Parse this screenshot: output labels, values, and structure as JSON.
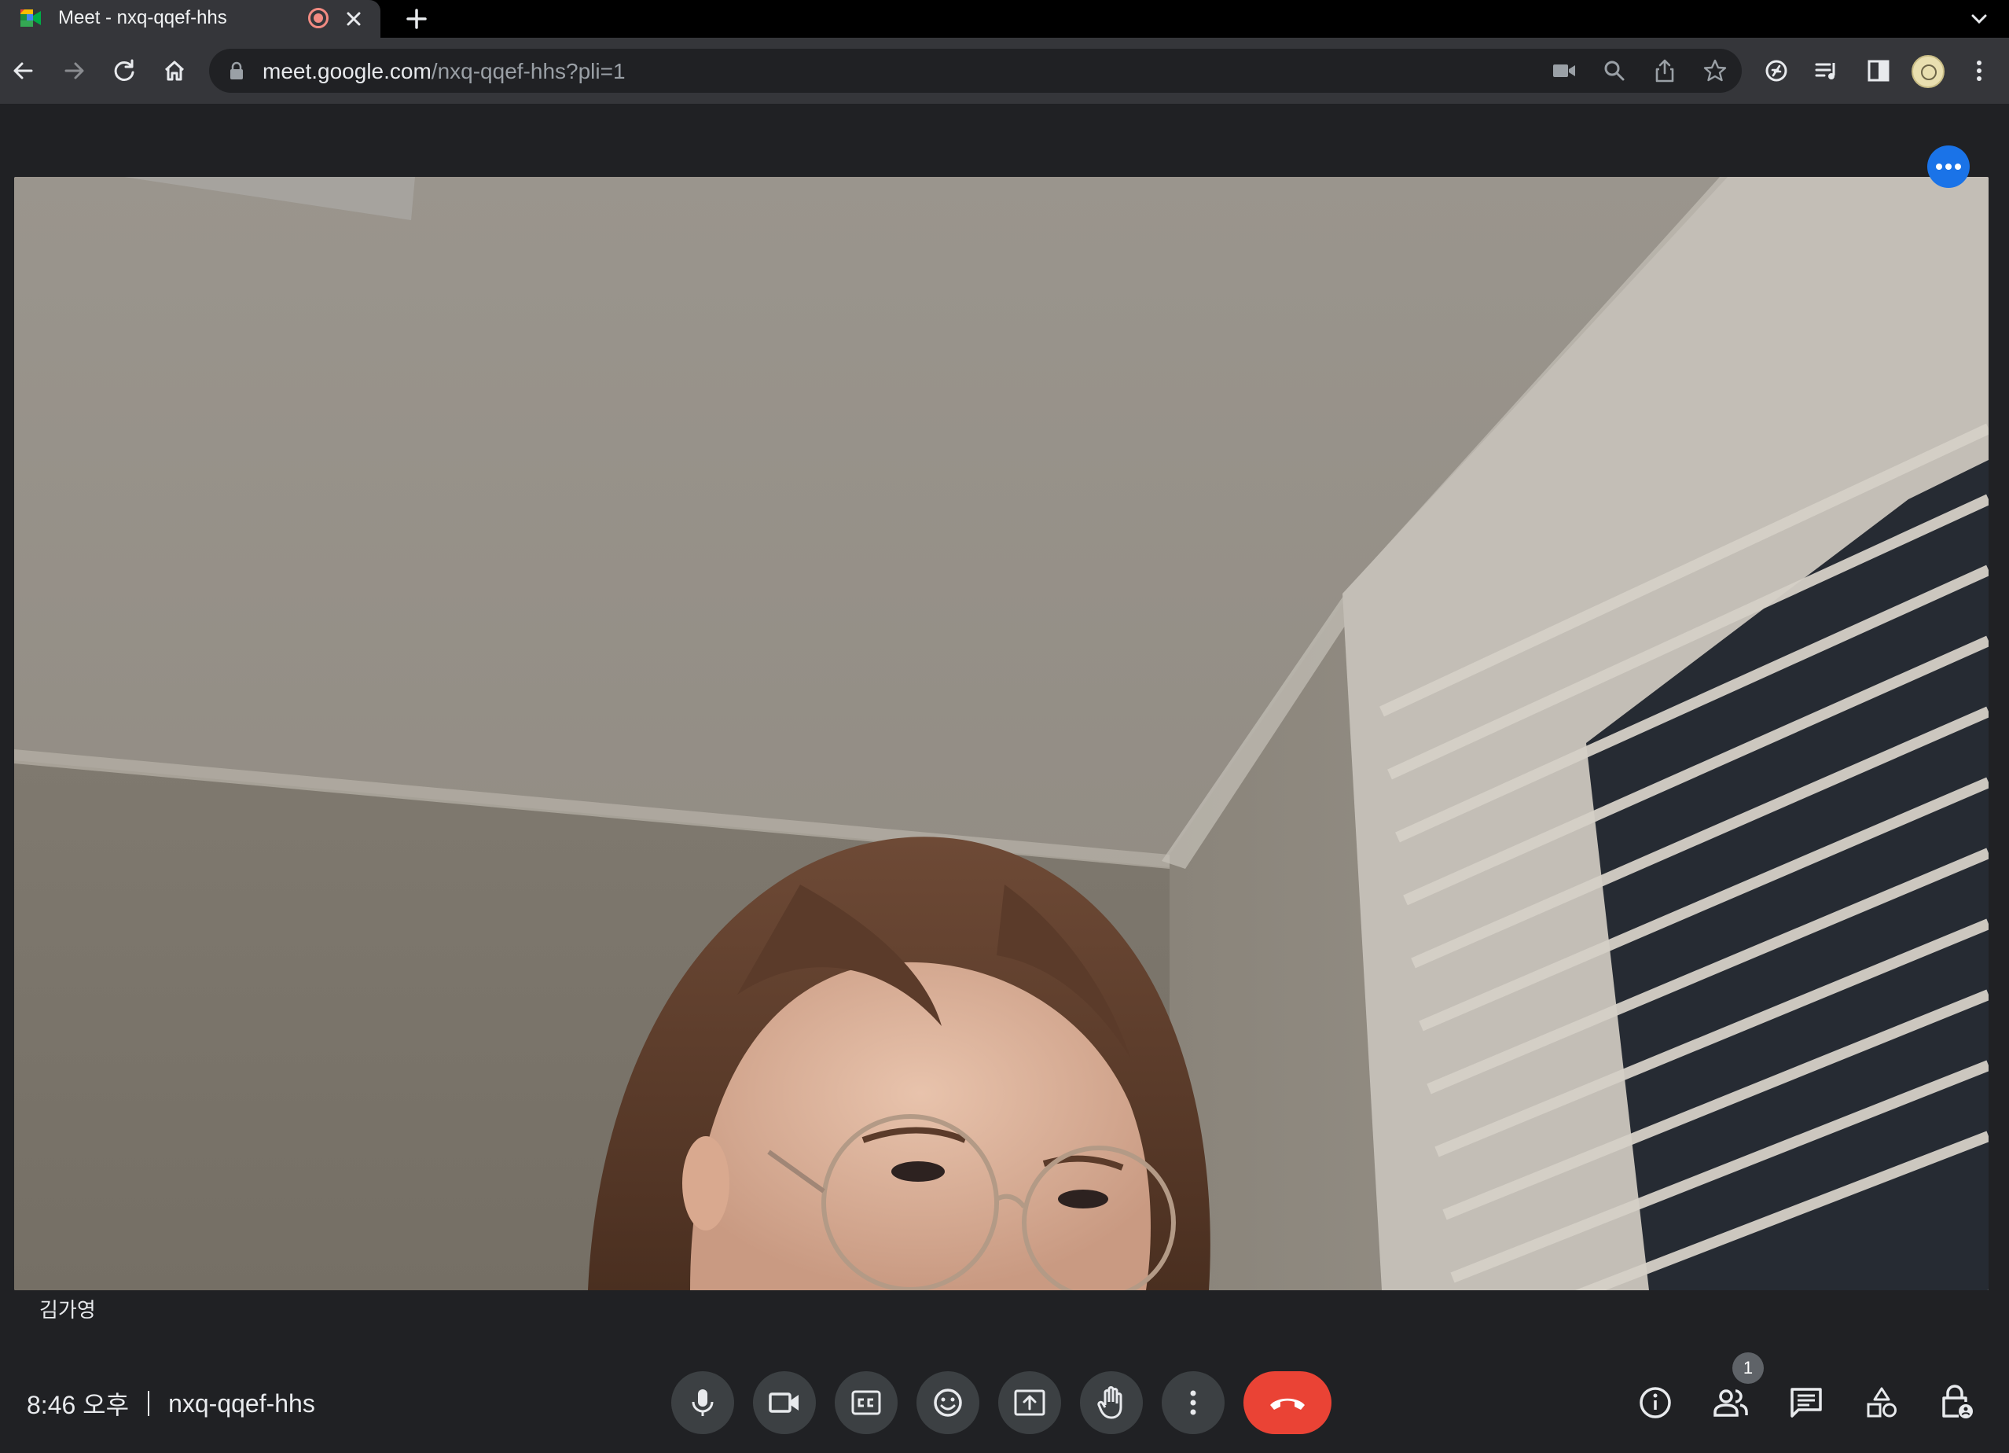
{
  "browser": {
    "tab": {
      "title": "Meet - nxq-qqef-hhs"
    },
    "address_bar": {
      "host": "meet.google.com",
      "path": "/nxq-qqef-hhs?pli=1"
    }
  },
  "meet": {
    "participant": {
      "name": "김가영"
    },
    "clock": "8:46 오후",
    "meeting_code": "nxq-qqef-hhs",
    "people_count": "1",
    "colors": {
      "hangup": "#ea4335",
      "accent": "#1a73e8",
      "control_bg": "#3c4043",
      "stage_bg": "#202124"
    }
  }
}
